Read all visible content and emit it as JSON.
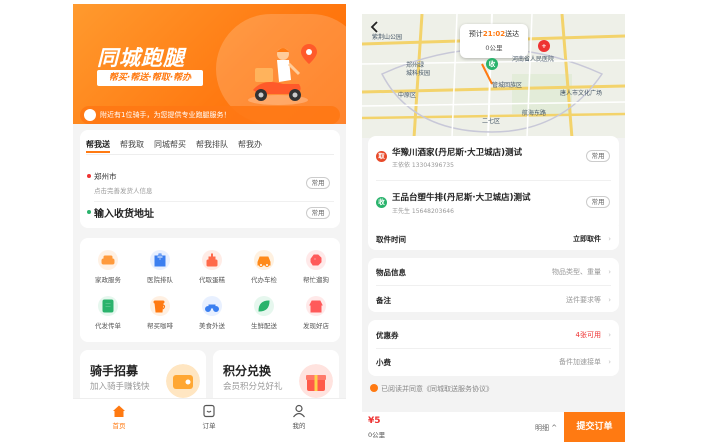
{
  "left": {
    "hero": {
      "title": "同城跑腿",
      "tagline": "帮买·帮送·帮取·帮办"
    },
    "notice": "附近有1位骑手，为您提供专业跑腿服务！",
    "tabs": [
      {
        "label": "帮我送",
        "active": true
      },
      {
        "label": "帮我取",
        "active": false
      },
      {
        "label": "同城帮买",
        "active": false
      },
      {
        "label": "帮我排队",
        "active": false
      },
      {
        "label": "帮我办",
        "active": false
      }
    ],
    "address": {
      "city": "郑州市",
      "city_hint": "点击完善发货人信息",
      "common_label": "常用",
      "receiver_placeholder": "输入收货地址",
      "receiver_common_label": "常用"
    },
    "services": [
      {
        "label": "家政服务",
        "icon": "sofa-icon",
        "color": "#ff9a3c",
        "bg": "#fff1e4"
      },
      {
        "label": "医院排队",
        "icon": "hospital-icon",
        "color": "#3b7ff0",
        "bg": "#e8f0ff"
      },
      {
        "label": "代取蛋糕",
        "icon": "cake-icon",
        "color": "#ff6a4a",
        "bg": "#ffece6"
      },
      {
        "label": "代办车检",
        "icon": "car-icon",
        "color": "#ff8a1a",
        "bg": "#fff1e0"
      },
      {
        "label": "帮忙遛狗",
        "icon": "dog-icon",
        "color": "#ff5a5a",
        "bg": "#ffe9e9"
      },
      {
        "label": "代发传单",
        "icon": "flyer-icon",
        "color": "#2ab36c",
        "bg": "#e6f7ee"
      },
      {
        "label": "帮买咖啡",
        "icon": "coffee-icon",
        "color": "#ff7a12",
        "bg": "#fff0e2"
      },
      {
        "label": "美食外送",
        "icon": "scooter-icon",
        "color": "#3b7ff0",
        "bg": "#e8f0ff"
      },
      {
        "label": "生鲜配送",
        "icon": "leaf-icon",
        "color": "#2ab36c",
        "bg": "#e6f7ee"
      },
      {
        "label": "发现好店",
        "icon": "shop-icon",
        "color": "#ff5a5a",
        "bg": "#ffe9e9"
      }
    ],
    "promos": [
      {
        "title": "骑手招募",
        "subtitle": "加入骑手赚钱快"
      },
      {
        "title": "积分兑换",
        "subtitle": "会员积分兑好礼"
      }
    ],
    "nav": [
      {
        "label": "首页",
        "icon": "home-icon",
        "active": true
      },
      {
        "label": "订单",
        "icon": "order-icon",
        "active": false
      },
      {
        "label": "我的",
        "icon": "user-icon",
        "active": false
      }
    ]
  },
  "right": {
    "map": {
      "eta_prefix": "预计",
      "eta_time": "21:02",
      "eta_suffix": "送达",
      "distance": "0公里",
      "labels": [
        "郑州绿",
        "城科技园",
        "中原区",
        "河南省人民医院",
        "唐人市文化广场",
        "二七区",
        "航海东路",
        "紫荆山公园",
        "管城回族区"
      ]
    },
    "pickup": {
      "tag": "取",
      "name": "华豫川酒家(丹尼斯·大卫城店)测试",
      "contact": "王依依 13304396735",
      "common_label": "常用"
    },
    "delivery": {
      "tag": "收",
      "name": "王品台塑牛排(丹尼斯·大卫城店)测试",
      "contact": "王先生 15648203646",
      "common_label": "常用"
    },
    "pickup_time": {
      "label": "取件时间",
      "value": "立即取件"
    },
    "item_info": {
      "label": "物品信息",
      "value": "物品类型、重量"
    },
    "remark": {
      "label": "备注",
      "value": "送件要求等"
    },
    "coupon": {
      "label": "优惠券",
      "value": "4张可用"
    },
    "tip": {
      "label": "小费",
      "value": "备件加速接单"
    },
    "agreement": "已阅读并同意《同城取送服务协议》",
    "footer": {
      "price": "¥5",
      "distance": "0公里",
      "detail": "明细 ^",
      "submit": "提交订单"
    }
  }
}
